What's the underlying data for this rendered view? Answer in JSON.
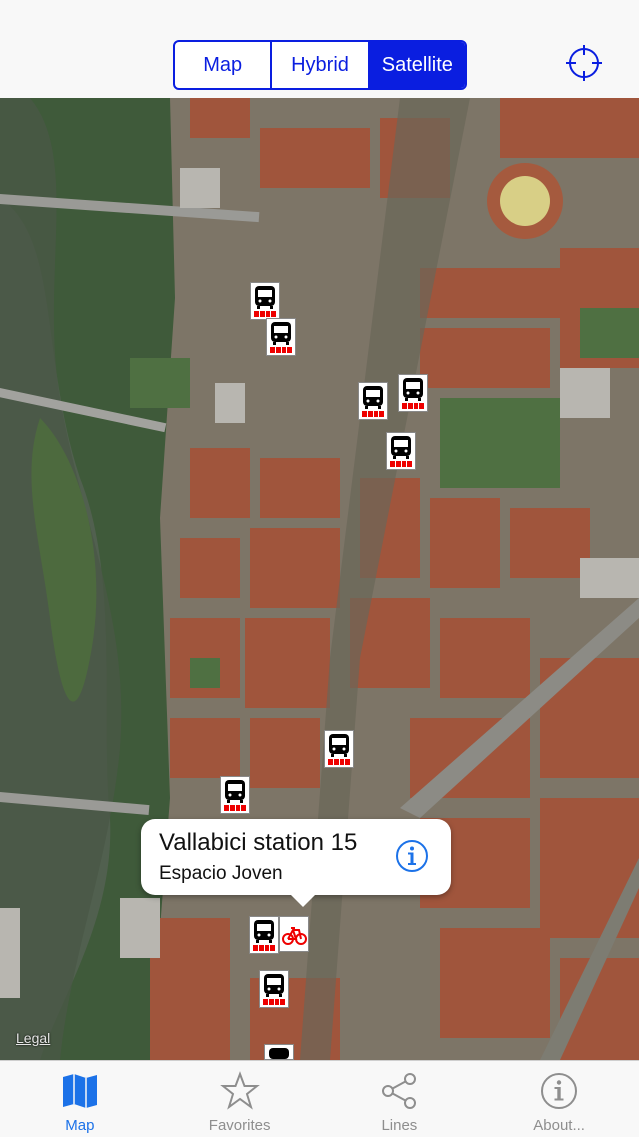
{
  "map_type_control": {
    "options": [
      "Map",
      "Hybrid",
      "Satellite"
    ],
    "selected": "Satellite"
  },
  "locate_button": {
    "icon": "crosshair-icon"
  },
  "map": {
    "legal_label": "Legal",
    "markers": [
      {
        "type": "bus"
      },
      {
        "type": "bus"
      },
      {
        "type": "bus"
      },
      {
        "type": "bus"
      },
      {
        "type": "bus"
      },
      {
        "type": "bus"
      },
      {
        "type": "bus"
      },
      {
        "type": "bus"
      },
      {
        "type": "bike"
      },
      {
        "type": "bus"
      },
      {
        "type": "bus"
      }
    ]
  },
  "callout": {
    "title": "Vallabici station 15",
    "subtitle": "Espacio Joven",
    "icon": "info-icon"
  },
  "tabbar": {
    "tabs": [
      {
        "label": "Map",
        "icon": "map-icon",
        "active": true
      },
      {
        "label": "Favorites",
        "icon": "star-icon",
        "active": false
      },
      {
        "label": "Lines",
        "icon": "share-icon",
        "active": false
      },
      {
        "label": "About...",
        "icon": "info-icon",
        "active": false
      }
    ]
  },
  "colors": {
    "accent": "#0a1ee0",
    "tab_active": "#1c72e8",
    "marker_bar": "#e00000"
  }
}
